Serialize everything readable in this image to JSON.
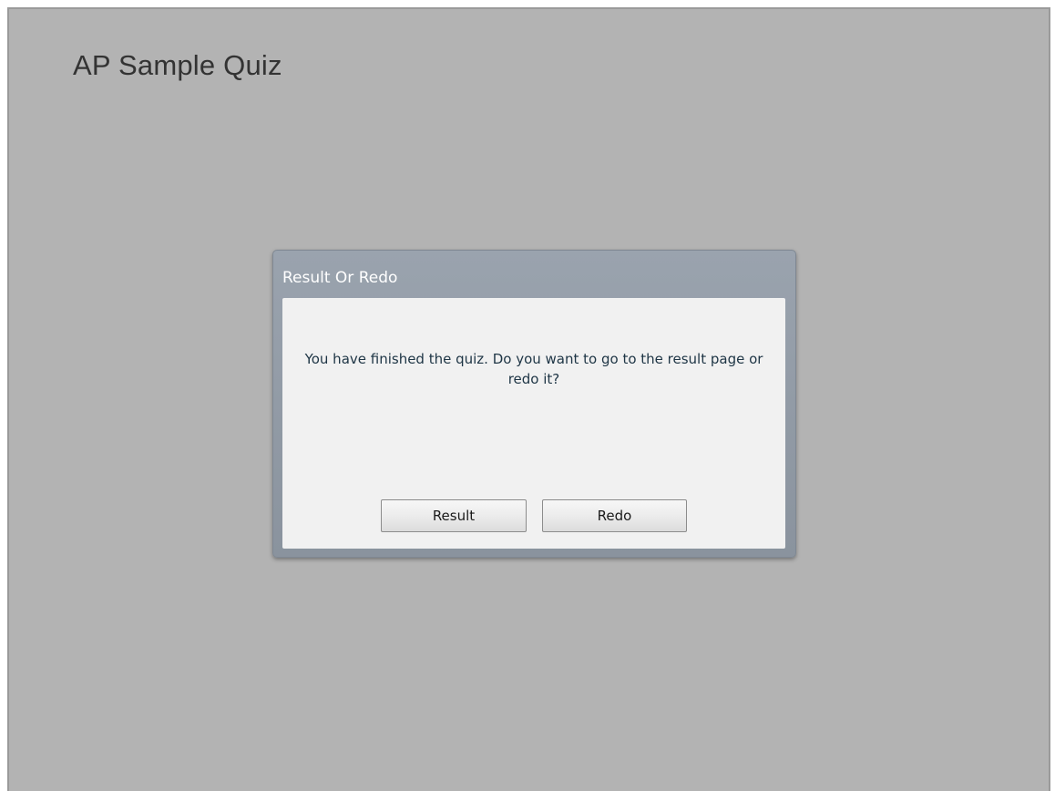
{
  "quiz": {
    "title": "AP Sample Quiz"
  },
  "dialog": {
    "title": "Result Or Redo",
    "message": "You have finished the quiz. Do you want to go to the result page or redo it?",
    "buttons": {
      "result_label": "Result",
      "redo_label": "Redo"
    }
  },
  "colors": {
    "stage_background": "#b3b3b3",
    "dialog_header": "#8f98a3",
    "dialog_body": "#f1f1f1",
    "message_text": "#1e3545"
  }
}
